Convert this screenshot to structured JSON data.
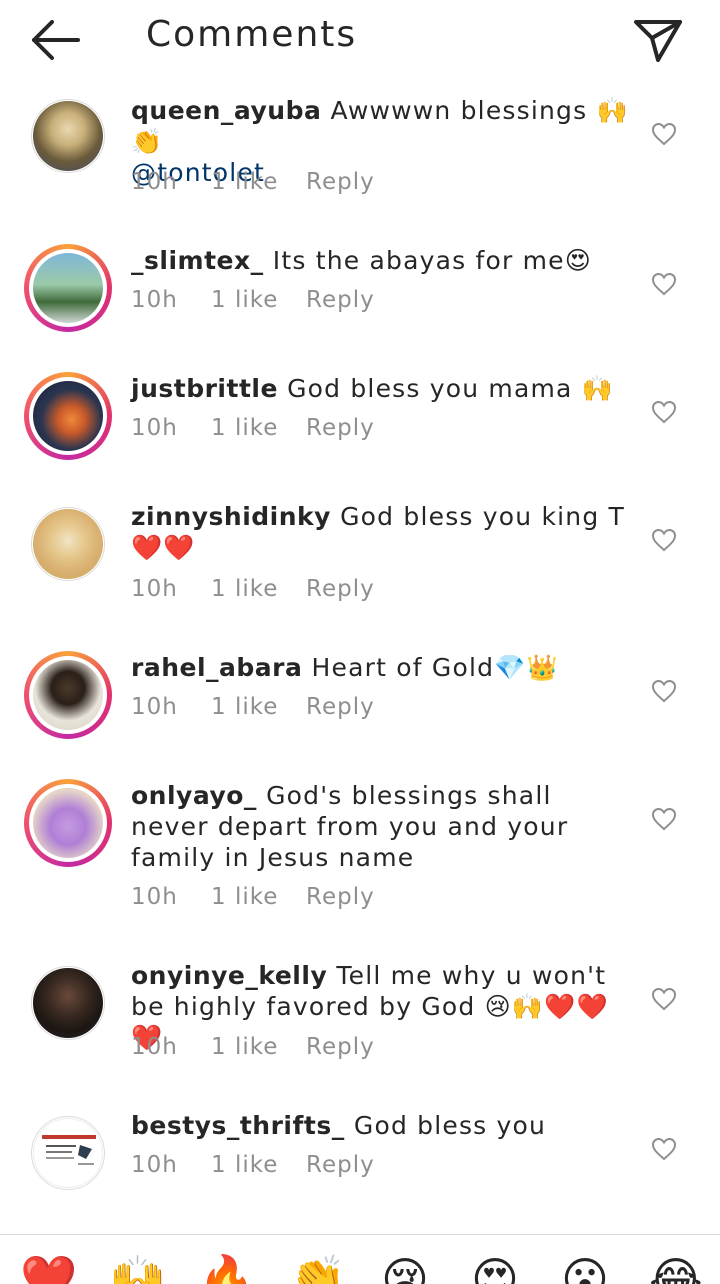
{
  "header": {
    "title": "Comments",
    "back_icon": "arrow-left-icon",
    "send_icon": "paper-plane-icon"
  },
  "comments": [
    {
      "username": "queen_ayuba",
      "text": "Awwwwn blessings 🙌👏",
      "mention": "@tontolet",
      "time": "10h",
      "likes": "1 like",
      "reply": "Reply",
      "story": false
    },
    {
      "username": "_slimtex_",
      "text": "Its the abayas for me😍",
      "mention": "",
      "time": "10h",
      "likes": "1 like",
      "reply": "Reply",
      "story": true
    },
    {
      "username": "justbrittle",
      "text": "God bless you mama 🙌",
      "mention": "",
      "time": "10h",
      "likes": "1 like",
      "reply": "Reply",
      "story": true
    },
    {
      "username": "zinnyshidinky",
      "text": "God bless you king T❤️❤️",
      "mention": "",
      "time": "10h",
      "likes": "1 like",
      "reply": "Reply",
      "story": false
    },
    {
      "username": "rahel_abara",
      "text": "Heart of Gold💎👑",
      "mention": "",
      "time": "10h",
      "likes": "1 like",
      "reply": "Reply",
      "story": true
    },
    {
      "username": "onlyayo_",
      "text": "God's blessings shall never depart from you and your family in Jesus name",
      "mention": "",
      "time": "10h",
      "likes": "1 like",
      "reply": "Reply",
      "story": true
    },
    {
      "username": "onyinye_kelly",
      "text": "Tell me why u won't be highly favored by God 😢🙌❤️❤️❤️",
      "mention": "",
      "time": "10h",
      "likes": "1 like",
      "reply": "Reply",
      "story": false
    },
    {
      "username": "bestys_thrifts_",
      "text": "God bless you",
      "mention": "",
      "time": "10h",
      "likes": "1 like",
      "reply": "Reply",
      "story": false
    }
  ],
  "quick_reactions": [
    "❤️",
    "🙌",
    "🔥",
    "👏",
    "😢",
    "😍",
    "😮",
    "😂"
  ],
  "colors": {
    "accent_ring_start": "#f9a13a",
    "accent_ring_end": "#c32aa3",
    "mention": "#003569",
    "meta": "#8e8e8e",
    "heart_red": "#ed4956"
  }
}
